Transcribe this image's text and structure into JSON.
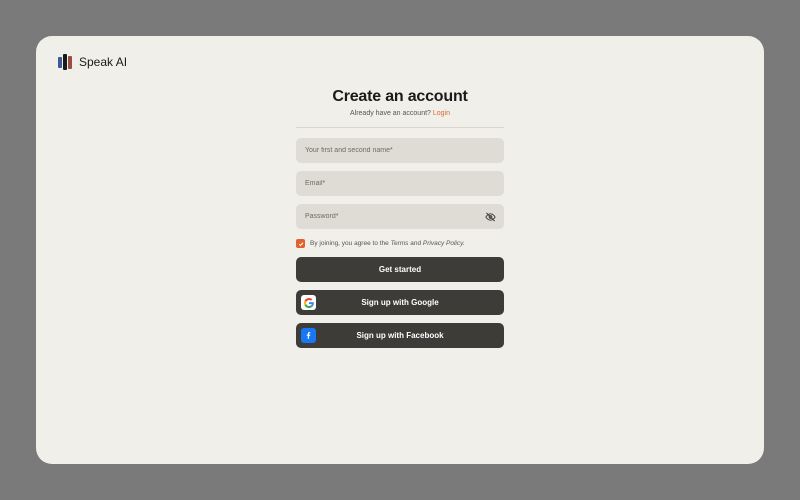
{
  "brand": {
    "name": "Speak AI"
  },
  "form": {
    "title": "Create an account",
    "subtext_prefix": "Already have an account? ",
    "subtext_link": "Login",
    "name_placeholder": "Your first and second name*",
    "email_placeholder": "Email*",
    "password_placeholder": "Password*",
    "agree_prefix": "By joining, you agree to the ",
    "agree_terms": "Terms",
    "agree_mid": " and ",
    "agree_privacy": "Privacy Policy.",
    "primary_button": "Get started",
    "google_button": "Sign up with Google",
    "facebook_button": "Sign up with Facebook"
  },
  "colors": {
    "card_bg": "#f0efe9",
    "accent": "#e0622d",
    "link": "#d86b2f",
    "button_bg": "#3d3c38",
    "field_bg": "#dedcd4"
  }
}
